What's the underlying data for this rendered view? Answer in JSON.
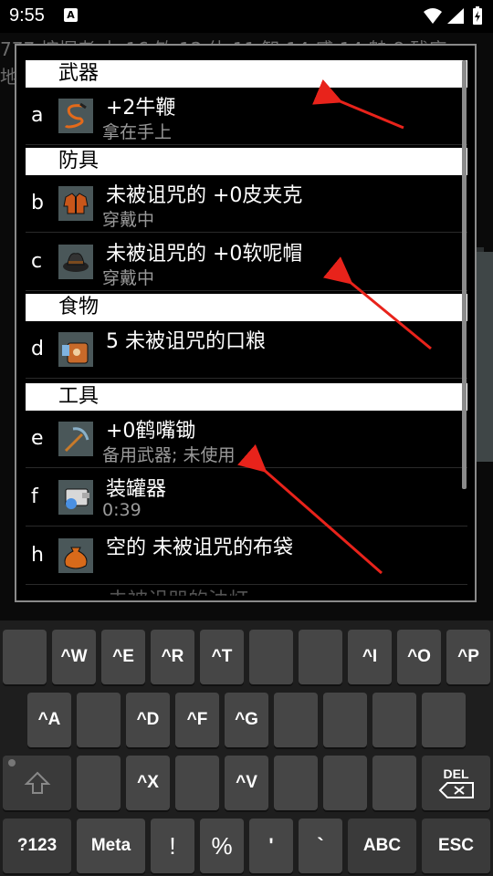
{
  "status_bar": {
    "time": "9:55",
    "notification_icon": "A"
  },
  "background": {
    "line1": "777 挖掘者         力:16 敏:12 体:11 智:14 感:14 魅:8 残庚",
    "line2": "地"
  },
  "inventory": {
    "sections": [
      {
        "title": "武器",
        "items": [
          {
            "letter": "a",
            "name": "+2牛鞭",
            "sub": "拿在手上",
            "icon": "bullwhip-icon"
          }
        ]
      },
      {
        "title": "防具",
        "items": [
          {
            "letter": "b",
            "name": "未被诅咒的 +0皮夹克",
            "sub": "穿戴中",
            "icon": "leather-jacket-icon"
          },
          {
            "letter": "c",
            "name": "未被诅咒的 +0软呢帽",
            "sub": "穿戴中",
            "icon": "fedora-icon"
          }
        ]
      },
      {
        "title": "食物",
        "items": [
          {
            "letter": "d",
            "name": "5 未被诅咒的口粮",
            "sub": "",
            "icon": "food-ration-icon"
          }
        ]
      },
      {
        "title": "工具",
        "items": [
          {
            "letter": "e",
            "name": "+0鹤嘴锄",
            "sub": "备用武器; 未使用",
            "icon": "pick-axe-icon"
          },
          {
            "letter": "f",
            "name": "装罐器",
            "sub": "0:39",
            "icon": "tinning-kit-icon"
          },
          {
            "letter": "h",
            "name": "空的 未被诅咒的布袋",
            "sub": "",
            "icon": "sack-icon"
          }
        ]
      }
    ],
    "cut_off_row": "未被诅咒的油灯"
  },
  "keyboard": {
    "row1": [
      "",
      "^W",
      "^E",
      "^R",
      "^T",
      "",
      "",
      "^I",
      "^O",
      "^P"
    ],
    "row2": [
      "^A",
      "",
      "^D",
      "^F",
      "^G",
      "",
      "",
      ""
    ],
    "row3": [
      "",
      "",
      "^X",
      "",
      "^V",
      "",
      "",
      "DEL"
    ],
    "row4": [
      "?123",
      "Meta",
      "!",
      "%",
      "'",
      "`",
      "ABC",
      "ESC"
    ]
  },
  "colors": {
    "annotation_arrow": "#e8231b",
    "header_bg": "#ffffff",
    "subtext": "#9a9a9a"
  }
}
